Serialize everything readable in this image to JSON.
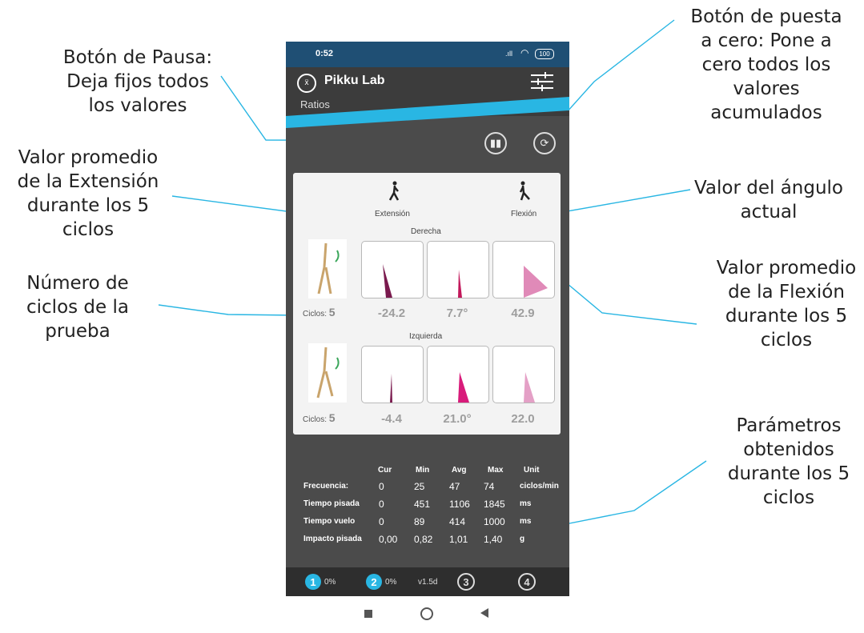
{
  "annotations": {
    "pause": [
      "Botón de Pausa:",
      "Deja fijos todos",
      "los valores"
    ],
    "reset": [
      "Botón de puesta",
      "a cero: Pone a",
      "cero todos los",
      "valores",
      "acumulados"
    ],
    "ext_avg": [
      "Valor promedio",
      "de la Extensión",
      "durante los 5",
      "ciclos"
    ],
    "angle": [
      "Valor del ángulo",
      "actual"
    ],
    "cycles": [
      "Número de",
      "ciclos de la",
      "prueba"
    ],
    "flex_avg": [
      "Valor promedio",
      "de la Flexión",
      "durante los 5",
      "ciclos"
    ],
    "params": [
      "Parámetros",
      "obtenidos",
      "durante los 5",
      "ciclos"
    ]
  },
  "status": {
    "time": "0:52",
    "battery": "100"
  },
  "app": {
    "title": "Pikku Lab",
    "subtitle": "Ratios"
  },
  "panel": {
    "extension_label": "Extensión",
    "flexion_label": "Flexión",
    "cycles_label": "Ciclos:",
    "right": {
      "label": "Derecha",
      "cycles": "5",
      "ext": "-24.2",
      "angle": "7.7°",
      "flex": "42.9"
    },
    "left": {
      "label": "Izquierda",
      "cycles": "5",
      "ext": "-4.4",
      "angle": "21.0°",
      "flex": "22.0"
    }
  },
  "stats": {
    "headers": [
      "Cur",
      "Min",
      "Avg",
      "Max",
      "Unit"
    ],
    "rows": [
      {
        "label": "Frecuencia:",
        "cur": "0",
        "min": "25",
        "avg": "47",
        "max": "74",
        "unit": "ciclos/min"
      },
      {
        "label": "Tiempo pisada",
        "cur": "0",
        "min": "451",
        "avg": "1106",
        "max": "1845",
        "unit": "ms"
      },
      {
        "label": "Tiempo vuelo",
        "cur": "0",
        "min": "89",
        "avg": "414",
        "max": "1000",
        "unit": "ms"
      },
      {
        "label": "Impacto pisada",
        "cur": "0,00",
        "min": "0,82",
        "avg": "1,01",
        "max": "1,40",
        "unit": "g"
      }
    ]
  },
  "bottom": {
    "s1": "1",
    "p1": "0%",
    "s2": "2",
    "p2": "0%",
    "version": "v1.5d",
    "s3": "3",
    "s4": "4"
  },
  "colors": {
    "accent": "#29b6e3",
    "ext": "#7a1a4e",
    "angle": "#c2185b",
    "flex": "#e08ab8",
    "leftangle": "#d81b7a",
    "leftflex": "#e4a0c6"
  }
}
